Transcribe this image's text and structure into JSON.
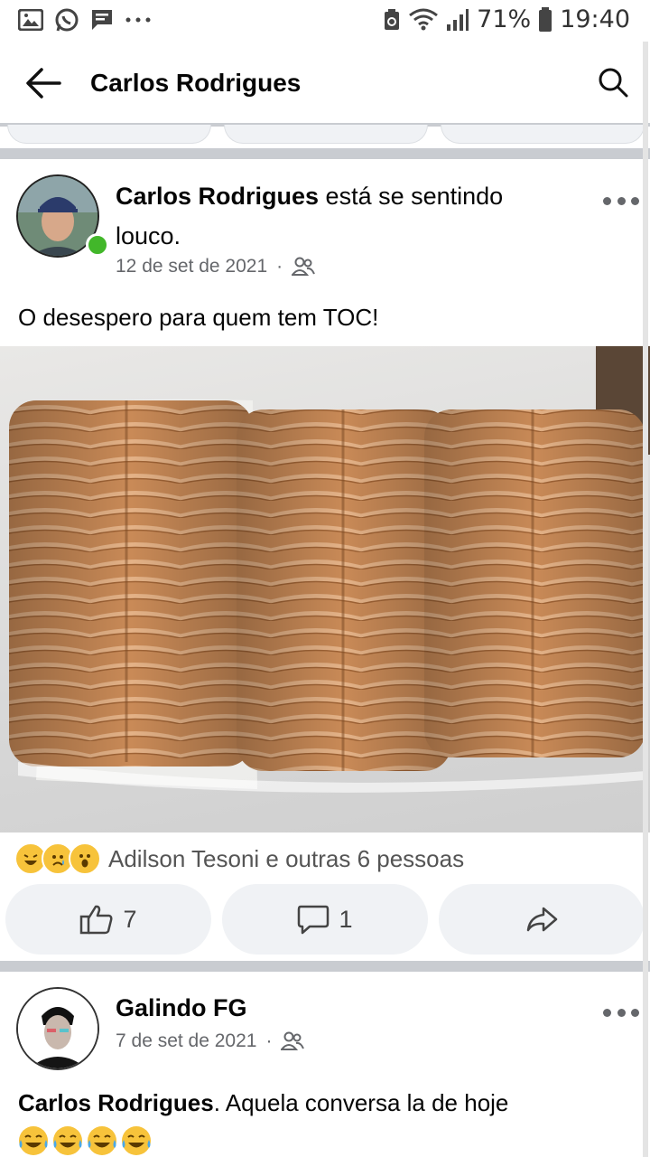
{
  "status_bar": {
    "battery": "71%",
    "time": "19:40",
    "left_icons": [
      "gallery-icon",
      "whatsapp-icon",
      "message-icon",
      "more-dots-icon"
    ]
  },
  "app_bar": {
    "title": "Carlos Rodrigues",
    "back_icon": "back-arrow-icon",
    "search_icon": "search-icon"
  },
  "post1": {
    "author": "Carlos Rodrigues",
    "feeling": " está se sentindo",
    "feeling2": "louco.",
    "date": "12 de set de 2021",
    "separator": "·",
    "privacy_icon": "friends-icon",
    "text": "O desespero para quem tem TOC!",
    "reaction_text": "Adilson Tesoni e outras 6 pessoas",
    "reaction_icons": [
      "laughing-emoji-icon",
      "sad-emoji-icon",
      "wow-emoji-icon"
    ],
    "like_count": "7",
    "comment_count": "1"
  },
  "post2": {
    "author": "Galindo FG",
    "date": "7 de set de 2021",
    "separator": "·",
    "privacy_icon": "friends-icon",
    "mention": "Carlos Rodrigues",
    "text": ". Aquela conversa la de hoje"
  },
  "colors": {
    "divider": "#c9ccd1",
    "pill": "#f0f2f5",
    "online": "#42b72a",
    "meta": "#65676b",
    "cookie": "#c98a57"
  }
}
